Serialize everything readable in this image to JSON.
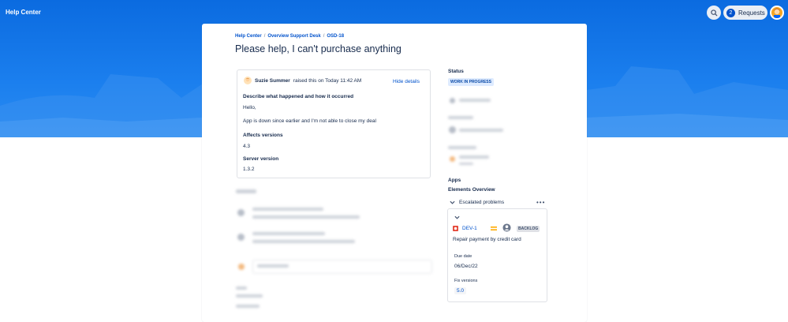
{
  "header": {
    "title": "Help Center",
    "requests_label": "Requests",
    "requests_count": "2"
  },
  "breadcrumb": [
    "Help Center",
    "Overview Support Desk",
    "OSD-18"
  ],
  "page_title": "Please help, I can't purchase anything",
  "request": {
    "reporter": "Suzie Summer",
    "raised_text": "raised this on Today 11:42 AM",
    "hide_details": "Hide details",
    "field1_label": "Describe what happened and how it occurred",
    "field1_line1": "Hello,",
    "field1_line2": "App is down since earlier and I'm not able to close my deal",
    "field2_label": "Affects versions",
    "field2_value": "4.3",
    "field3_label": "Server version",
    "field3_value": "1.3.2"
  },
  "sidebar": {
    "status_label": "Status",
    "status_value": "WORK IN PROGRESS",
    "apps_label": "Apps",
    "elements_overview": "Elements Overview",
    "escalated_label": "Escalated problems",
    "more_label": "•••",
    "issue": {
      "key": "DEV-1",
      "status": "BACKLOG",
      "summary": "Repair payment by credit card",
      "due_label": "Due date",
      "due_value": "06/Dec/22",
      "fix_label": "Fix versions",
      "fix_value": "5.0"
    }
  },
  "colors": {
    "hero": "#0b6be0",
    "link": "#0052cc",
    "status_pill_bg": "#deebff",
    "priority": "#ffab00",
    "bug": "#e5493a"
  }
}
